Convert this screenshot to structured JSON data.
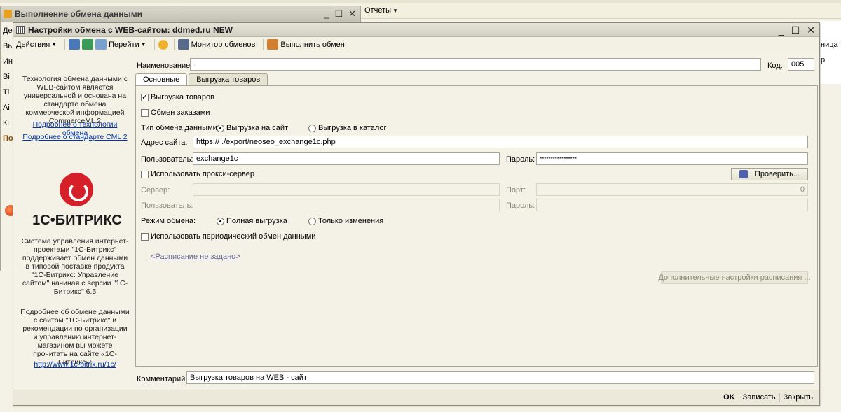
{
  "background": {
    "reports_menu": "Отчеты",
    "right_panel_t1": "ница",
    "right_panel_t2": "р"
  },
  "window1": {
    "title": "Выполнение обмена данными",
    "left_items": [
      "Де",
      "Вь",
      "Ин",
      "Ві",
      "Ті",
      "Аі",
      "Кі",
      "По"
    ]
  },
  "dialog": {
    "title": "Настройки обмена с WEB-сайтом: ddmed.ru NEW",
    "toolbar": {
      "actions": "Действия",
      "goto": "Перейти",
      "monitor": "Монитор обменов",
      "execute": "Выполнить обмен"
    },
    "info": {
      "p1": "Технология обмена данными с WEB-сайтом является универсальной и основана на стандарте обмена коммерческой информацией CommerceML 2",
      "link1": "Подробнее о технологии обмена",
      "link2": "Подробнее о стандарте CML 2",
      "logo": "1С•БИТРИКС",
      "p2": "Система управления интернет-проектами \"1С-Битрикс\" поддерживает обмен данными в типовой поставке продукта \"1С-Битрикс: Управление сайтом\" начиная с версии \"1С-Битрикс\" 6.5",
      "p3": "Подробнее об обмене данными с сайтом \"1С-Битрикс\" и рекомендации по организации и управлению интернет-магазином вы можете прочитать на сайте «1С-Битрикс»:",
      "link3": "http://www.1c-bitrix.ru/1c/"
    },
    "form": {
      "name_label": "Наименование:",
      "name_value": ".",
      "code_label": "Код:",
      "code_value": "005",
      "tabs": [
        "Основные",
        "Выгрузка товаров"
      ],
      "chk_export_goods": "Выгрузка товаров",
      "chk_exchange_orders": "Обмен заказами",
      "exchange_type_label": "Тип обмена данными:",
      "radio_to_site": "Выгрузка на сайт",
      "radio_to_catalog": "Выгрузка в каталог",
      "site_address_label": "Адрес сайта:",
      "site_address_value": "https://              ./export/neoseo_exchange1c.php",
      "user_label": "Пользователь:",
      "user_value": "exchange1c",
      "password_label": "Пароль:",
      "password_value": "*****************",
      "chk_proxy": "Использовать прокси-сервер",
      "check_button": "Проверить...",
      "server_label": "Сервер:",
      "port_label": "Порт:",
      "port_value": "0",
      "proxy_user_label": "Пользователь:",
      "proxy_password_label": "Пароль:",
      "mode_label": "Режим обмена:",
      "radio_full": "Полная выгрузка",
      "radio_changes": "Только изменения",
      "chk_periodic": "Использовать периодический обмен данными",
      "schedule_link": "<Расписание не задано>",
      "extra_schedule_button": "Дополнительные настройки расписания ...",
      "comment_label": "Комментарий:",
      "comment_value": "Выгрузка товаров на WEB - сайт"
    },
    "bottom": {
      "ok": "OK",
      "save": "Записать",
      "close": "Закрыть"
    }
  }
}
